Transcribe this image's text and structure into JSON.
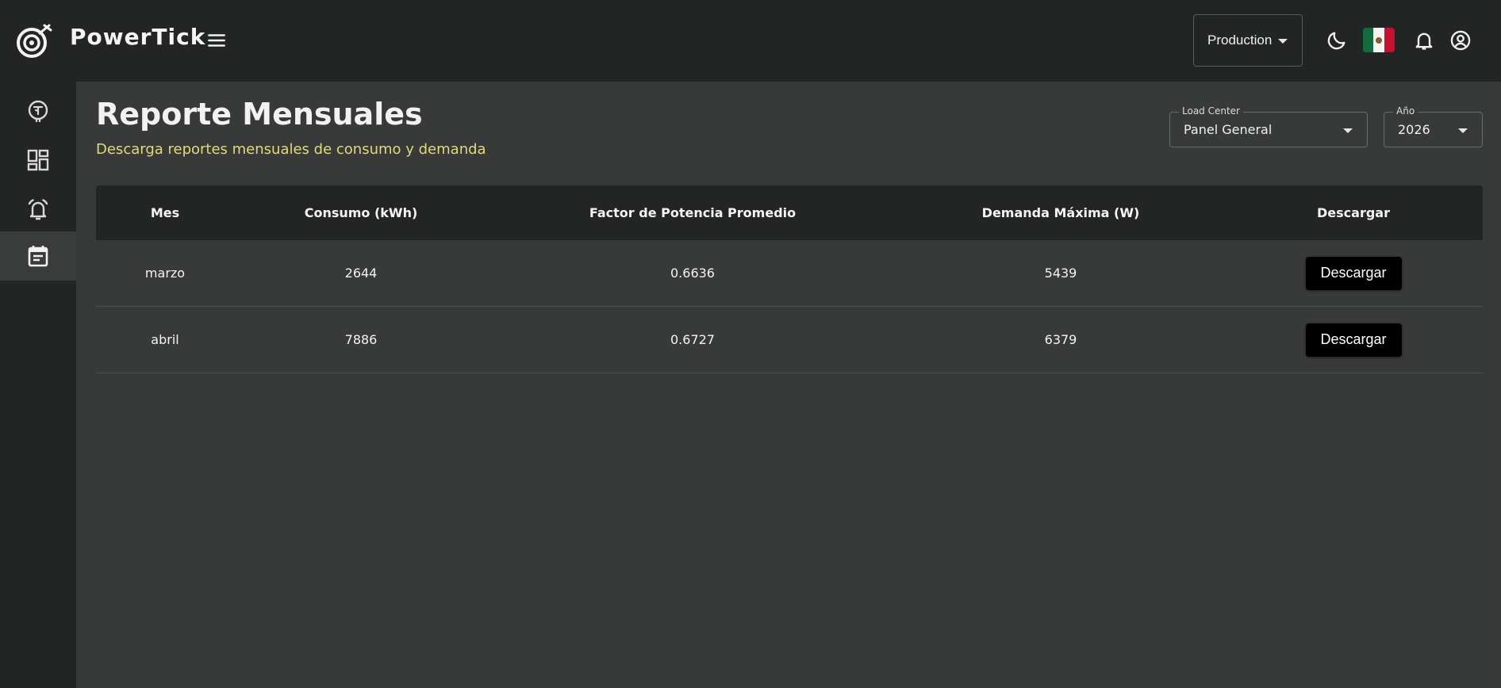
{
  "app": {
    "brand": "PowerTick",
    "environment": "Production",
    "flag": "mexico-flag",
    "colors": {
      "topbar": "#232424",
      "background": "#383939",
      "subtitle": "#e3d978",
      "button": "#000000"
    }
  },
  "sidebar": {
    "items": [
      {
        "icon": "power-tick-coin-icon"
      },
      {
        "icon": "dashboard-icon"
      },
      {
        "icon": "alarm-bell-icon"
      },
      {
        "icon": "calendar-report-icon",
        "active": true
      }
    ]
  },
  "page": {
    "title": "Reporte Mensuales",
    "subtitle": "Descarga reportes mensuales de consumo y demanda"
  },
  "filters": {
    "load_center": {
      "label": "Load Center",
      "value": "Panel General"
    },
    "year": {
      "label": "Año",
      "value": "2026"
    }
  },
  "table": {
    "headers": [
      "Mes",
      "Consumo (kWh)",
      "Factor de Potencia Promedio",
      "Demanda Máxima (W)",
      "Descargar"
    ],
    "rows": [
      {
        "mes": "marzo",
        "consumo": "2644",
        "factor": "0.6636",
        "demanda": "5439",
        "action": "Descargar"
      },
      {
        "mes": "abril",
        "consumo": "7886",
        "factor": "0.6727",
        "demanda": "6379",
        "action": "Descargar"
      }
    ]
  }
}
